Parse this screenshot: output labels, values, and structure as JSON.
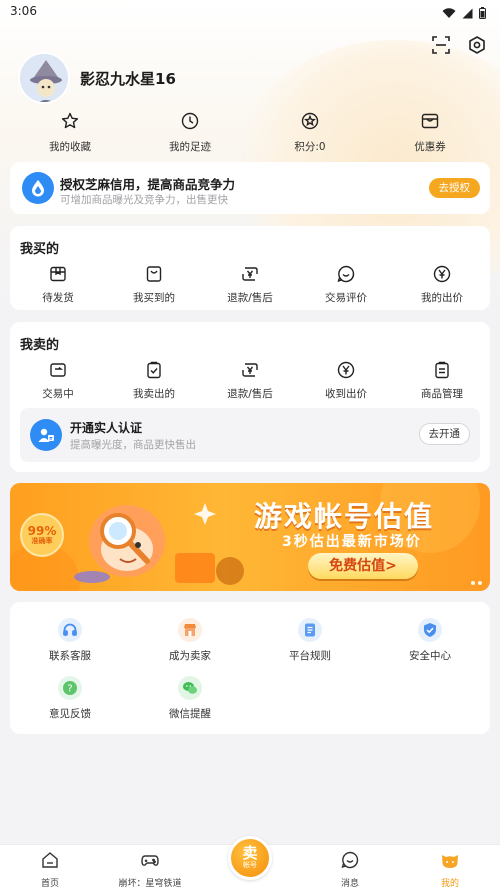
{
  "status_bar": {
    "time": "3:06"
  },
  "profile": {
    "username": "影忍九水星16"
  },
  "header": {
    "icons": [
      "scan-icon",
      "settings-icon"
    ]
  },
  "quick_actions": [
    {
      "label": "我的收藏",
      "icon": "star-icon"
    },
    {
      "label": "我的足迹",
      "icon": "clock-icon"
    },
    {
      "label": "积分:0",
      "icon": "points-icon"
    },
    {
      "label": "优惠券",
      "icon": "coupon-icon"
    }
  ],
  "auth_card": {
    "title": "授权芝麻信用，提高商品竞争力",
    "subtitle": "可增加商品曝光及竞争力，出售更快",
    "button": "去授权"
  },
  "buy_section": {
    "title": "我买的",
    "items": [
      {
        "label": "待发货",
        "icon": "box-icon"
      },
      {
        "label": "我买到的",
        "icon": "bag-icon"
      },
      {
        "label": "退款/售后",
        "icon": "refund-icon"
      },
      {
        "label": "交易评价",
        "icon": "smile-icon"
      },
      {
        "label": "我的出价",
        "icon": "yen-icon"
      }
    ]
  },
  "sell_section": {
    "title": "我卖的",
    "items": [
      {
        "label": "交易中",
        "icon": "wallet-icon"
      },
      {
        "label": "我卖出的",
        "icon": "clipboard-check-icon"
      },
      {
        "label": "退款/售后",
        "icon": "refund-icon"
      },
      {
        "label": "收到出价",
        "icon": "yen-icon"
      },
      {
        "label": "商品管理",
        "icon": "list-icon"
      }
    ],
    "verify": {
      "title": "开通实人认证",
      "subtitle": "提高曝光度，商品更快售出",
      "button": "去开通"
    }
  },
  "banner": {
    "title": "游戏帐号估值",
    "subtitle": "3秒估出最新市场价",
    "button": "免费估值>",
    "badge_percent": "99%",
    "badge_text": "准确率"
  },
  "services": [
    {
      "label": "联系客服",
      "icon": "headset-icon",
      "color": "#4a8ff0"
    },
    {
      "label": "成为卖家",
      "icon": "shop-icon",
      "color": "#f28a3c"
    },
    {
      "label": "平台规则",
      "icon": "document-icon",
      "color": "#5b9cf2"
    },
    {
      "label": "安全中心",
      "icon": "shield-icon",
      "color": "#4a8ff0"
    },
    {
      "label": "意见反馈",
      "icon": "question-icon",
      "color": "#5cc46a"
    },
    {
      "label": "微信提醒",
      "icon": "wechat-icon",
      "color": "#3fbe56"
    }
  ],
  "bottom_nav": [
    {
      "label": "首页",
      "icon": "home-icon",
      "active": false
    },
    {
      "label": "崩坏：星穹铁道",
      "icon": "gamepad-icon",
      "active": false
    },
    {
      "label": "",
      "icon": "sell-fab",
      "active": false
    },
    {
      "label": "消息",
      "icon": "message-icon",
      "active": false
    },
    {
      "label": "我的",
      "icon": "cat-face-icon",
      "active": true
    }
  ],
  "sell_fab": {
    "big": "卖",
    "small": "帐号"
  },
  "colors": {
    "accent": "#f5a71f",
    "blue": "#2f8cf5",
    "bg": "#f3f3f5"
  }
}
